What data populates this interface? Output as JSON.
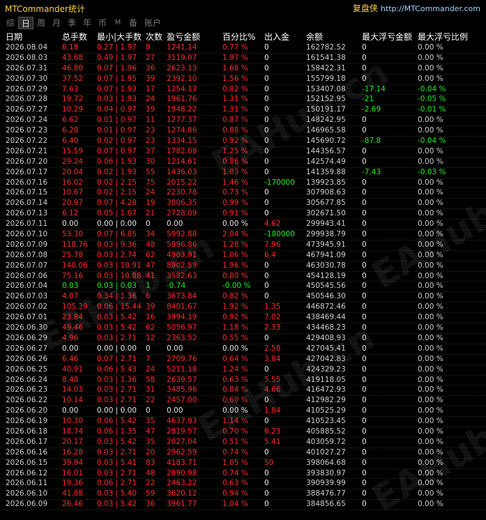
{
  "app": {
    "title": "MTCommander统计",
    "brand": "复盘侠",
    "url": "http://MTCommander.com"
  },
  "tabs": [
    {
      "label": "综",
      "active": false
    },
    {
      "label": "日",
      "active": true
    },
    {
      "label": "周",
      "active": false
    },
    {
      "label": "月",
      "active": false
    },
    {
      "label": "季",
      "active": false
    },
    {
      "label": "年",
      "active": false
    },
    {
      "label": "币",
      "active": false
    },
    {
      "label": "M",
      "active": false
    },
    {
      "label": "备",
      "active": false
    },
    {
      "label": "账户",
      "active": false
    }
  ],
  "columns": {
    "date": "日期",
    "lots": "总手数",
    "minmax": "最小|大手数",
    "count": "次数",
    "profit": "盈亏金额",
    "pct": "百分比%",
    "flow": "出入金",
    "balance": "余额",
    "maxdd": "最大浮亏金额",
    "maxddpct": "最大浮亏比例"
  },
  "watermark": "EAHub.cn",
  "rows": [
    [
      "2026.08.04",
      "6.18",
      "0.27 | 1.97",
      "8",
      "1241.14",
      "0.77 %",
      "0",
      "162782.52",
      "0",
      "0.00 %",
      "r"
    ],
    [
      "2026.08.03",
      "43.68",
      "0.49 | 1.97",
      "27",
      "3119.07",
      "1.97 %",
      "0",
      "161541.38",
      "0",
      "0.00 %",
      "r"
    ],
    [
      "2026.07.31",
      "46.80",
      "0.07 | 1.96",
      "36",
      "2623.13",
      "1.68 %",
      "0",
      "158422.31",
      "0",
      "0.00 %",
      "r"
    ],
    [
      "2026.07.30",
      "37.52",
      "0.07 | 1.95",
      "39",
      "2392.10",
      "1.56 %",
      "0",
      "155799.18",
      "0",
      "0.00 %",
      "r"
    ],
    [
      "2026.07.29",
      "7.63",
      "0.07 | 1.93",
      "17",
      "1254.13",
      "0.82 %",
      "0",
      "153407.08",
      "-17.14",
      "-0.04 %",
      "r"
    ],
    [
      "2026.07.28",
      "19.72",
      "0.03 | 1.93",
      "24",
      "1961.76",
      "1.31 %",
      "0",
      "152152.95",
      "-21",
      "-0.05 %",
      "r"
    ],
    [
      "2026.07.27",
      "10.29",
      "0.04 | 0.97",
      "19",
      "1948.22",
      "1.31 %",
      "0",
      "150191.17",
      "-2.69",
      "-0.01 %",
      "r"
    ],
    [
      "2026.07.24",
      "6.62",
      "0.01 | 0.97",
      "11",
      "1277.37",
      "0.87 %",
      "0",
      "148242.95",
      "0",
      "0.00 %",
      "r"
    ],
    [
      "2026.07.23",
      "6.28",
      "0.01 | 0.97",
      "23",
      "1274.86",
      "0.88 %",
      "0",
      "146965.58",
      "0",
      "0.00 %",
      "r"
    ],
    [
      "2026.07.22",
      "6.40",
      "0.02 | 0.97",
      "23",
      "1334.15",
      "0.92 %",
      "0",
      "145690.72",
      "-87.8",
      "-0.04 %",
      "r"
    ],
    [
      "2026.07.21",
      "15.59",
      "0.07 | 0.97",
      "37",
      "1782.08",
      "1.25 %",
      "0",
      "144356.57",
      "0",
      "0.00 %",
      "r"
    ],
    [
      "2026.07.20",
      "29.24",
      "0.06 | 1.93",
      "30",
      "1214.61",
      "0.86 %",
      "0",
      "142574.49",
      "0",
      "0.00 %",
      "r"
    ],
    [
      "2026.07.17",
      "20.04",
      "0.02 | 1.93",
      "55",
      "1436.03",
      "1.03 %",
      "0",
      "141359.88",
      "-7.43",
      "-0.03 %",
      "r"
    ],
    [
      "2026.07.16",
      "16.02",
      "0.02 | 2.15",
      "75",
      "2015.22",
      "1.46 %",
      "-170000",
      "139923.85",
      "0",
      "0.00 %",
      "r"
    ],
    [
      "2026.07.15",
      "10.67",
      "0.02 | 2.15",
      "24",
      "2230.78",
      "0.73 %",
      "0",
      "307908.63",
      "0",
      "0.00 %",
      "r"
    ],
    [
      "2026.07.14",
      "20.97",
      "0.07 | 4.28",
      "19",
      "3006.35",
      "0.99 %",
      "0",
      "305677.85",
      "0",
      "0.00 %",
      "r"
    ],
    [
      "2026.07.13",
      "6.12",
      "0.05 | 1.07",
      "21",
      "2728.09",
      "0.91 %",
      "0",
      "302671.50",
      "0",
      "0.00 %",
      "r"
    ],
    [
      "2026.07.11",
      "0.00",
      "0.00 | 0.00",
      "0",
      "0.00",
      "0.00 %",
      "4.62",
      "299943.41",
      "0",
      "0.00 %",
      "w"
    ],
    [
      "2026.07.10",
      "53.30",
      "0.07 | 6.85",
      "34",
      "5992.88",
      "2.04 %",
      "-180000",
      "299938.79",
      "0",
      "0.00 %",
      "r"
    ],
    [
      "2026.07.09",
      "118.76",
      "0.03 | 9.36",
      "48",
      "5996.86",
      "1.28 %",
      "7.96",
      "473945.91",
      "0",
      "0.00 %",
      "r"
    ],
    [
      "2026.07.08",
      "25.78",
      "0.03 | 2.74",
      "62",
      "4903.91",
      "1.06 %",
      "6.4",
      "467941.09",
      "0",
      "0.00 %",
      "r"
    ],
    [
      "2026.07.07",
      "140.06",
      "0.03 | 10.91",
      "47",
      "8902.59",
      "1.96 %",
      "0",
      "463030.78",
      "0",
      "0.00 %",
      "r"
    ],
    [
      "2026.07.06",
      "75.16",
      "0.03 | 10.88",
      "41",
      "3582.63",
      "0.80 %",
      "0",
      "454128.19",
      "0",
      "0.00 %",
      "r"
    ],
    [
      "2026.07.04",
      "0.03",
      "0.03 | 0.03",
      "1",
      "-0.74",
      "-0.00 %",
      "0",
      "450545.56",
      "0",
      "0.00 %",
      "g"
    ],
    [
      "2026.07.03",
      "4.07",
      "0.34 | 1.36",
      "6",
      "3673.84",
      "0.82 %",
      "0",
      "450546.30",
      "0",
      "0.00 %",
      "r"
    ],
    [
      "2026.07.02",
      "105.39",
      "0.06 | 15.44",
      "39",
      "8401.67",
      "1.92 %",
      "1.35",
      "446872.46",
      "0",
      "0.00 %",
      "r"
    ],
    [
      "2026.07.01",
      "23.84",
      "0.03 | 5.42",
      "16",
      "3994.19",
      "0.92 %",
      "7.02",
      "438469.44",
      "0",
      "0.00 %",
      "r"
    ],
    [
      "2026.06.30",
      "49.46",
      "0.03 | 5.42",
      "62",
      "5056.97",
      "1.18 %",
      "2.33",
      "434468.23",
      "0",
      "0.00 %",
      "r"
    ],
    [
      "2026.06.29",
      "4.96",
      "0.03 | 2.71",
      "12",
      "2363.52",
      "0.55 %",
      "0",
      "429408.93",
      "0",
      "0.00 %",
      "r"
    ],
    [
      "2026.06.27",
      "0.00",
      "0.00 | 0.00",
      "0",
      "0.00",
      "0.00 %",
      "2.58",
      "427045.41",
      "0",
      "0.00 %",
      "w"
    ],
    [
      "2026.06.26",
      "6.46",
      "0.07 | 2.71",
      "7",
      "2709.76",
      "0.64 %",
      "3.84",
      "427042.83",
      "0",
      "0.00 %",
      "r"
    ],
    [
      "2026.06.25",
      "40.91",
      "0.06 | 5.43",
      "24",
      "5211.18",
      "1.24 %",
      "0",
      "424329.23",
      "0",
      "0.00 %",
      "r"
    ],
    [
      "2026.06.24",
      "8.48",
      "0.03 | 1.36",
      "58",
      "2639.57",
      "0.63 %",
      "5.55",
      "419118.05",
      "0",
      "0.00 %",
      "r"
    ],
    [
      "2026.06.23",
      "14.03",
      "0.03 | 2.71",
      "31",
      "3485.96",
      "0.84 %",
      "4.66",
      "416472.93",
      "0",
      "0.00 %",
      "r"
    ],
    [
      "2026.06.22",
      "10.14",
      "0.03 | 2.71",
      "22",
      "2457.00",
      "0.60 %",
      "0",
      "412982.29",
      "0",
      "0.00 %",
      "r"
    ],
    [
      "2026.06.20",
      "0.00",
      "0.00 | 0.00",
      "0",
      "0.00",
      "0.00 %",
      "1.84",
      "410525.29",
      "0",
      "0.00 %",
      "w"
    ],
    [
      "2026.06.19",
      "10.30",
      "0.06 | 5.42",
      "35",
      "4637.93",
      "1.14 %",
      "0",
      "410523.45",
      "0",
      "0.00 %",
      "r"
    ],
    [
      "2026.06.18",
      "18.74",
      "0.06 | 1.35",
      "47",
      "2819.57",
      "0.70 %",
      "6.23",
      "405885.52",
      "0",
      "0.00 %",
      "r"
    ],
    [
      "2026.06.17",
      "20.17",
      "0.03 | 5.42",
      "35",
      "2027.04",
      "0.51 %",
      "5.41",
      "403059.72",
      "0",
      "0.00 %",
      "r"
    ],
    [
      "2026.06.16",
      "16.28",
      "0.03 | 2.71",
      "20",
      "2962.59",
      "0.74 %",
      "0",
      "401027.27",
      "0",
      "0.00 %",
      "r"
    ],
    [
      "2026.06.15",
      "39.94",
      "0.03 | 5.41",
      "83",
      "4183.71",
      "1.05 %",
      "50",
      "398064.68",
      "0",
      "0.00 %",
      "r"
    ],
    [
      "2026.06.12",
      "16.01",
      "0.03 | 2.71",
      "48",
      "2890.98",
      "0.74 %",
      "0",
      "393830.97",
      "0",
      "0.00 %",
      "r"
    ],
    [
      "2026.06.11",
      "19.36",
      "0.06 | 2.71",
      "22",
      "2463.22",
      "0.63 %",
      "0",
      "390939.99",
      "0",
      "0.00 %",
      "r"
    ],
    [
      "2026.06.10",
      "41.88",
      "0.03 | 5.40",
      "59",
      "3620.12",
      "0.94 %",
      "0",
      "388476.77",
      "0",
      "0.00 %",
      "r"
    ],
    [
      "2026.06.09",
      "26.46",
      "0.03 | 5.42",
      "36",
      "3961.77",
      "1.04 %",
      "0",
      "384856.65",
      "0",
      "0.00 %",
      "r"
    ]
  ]
}
